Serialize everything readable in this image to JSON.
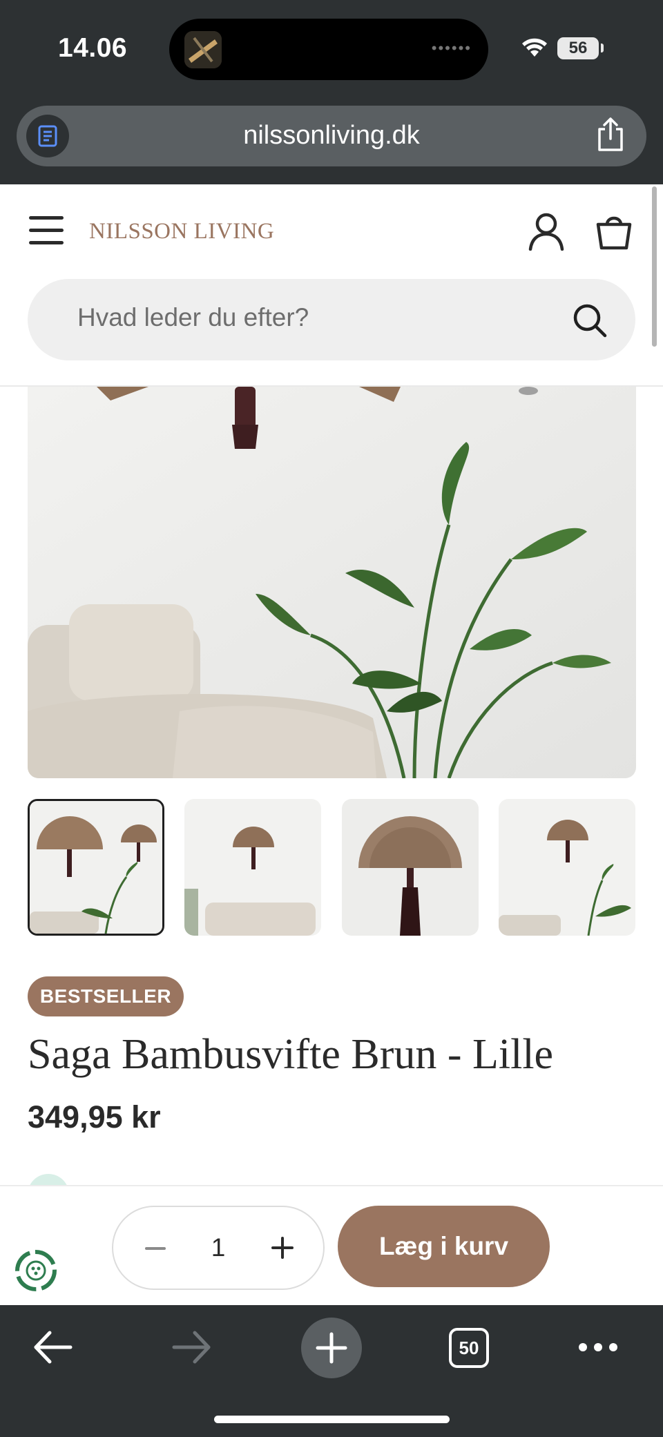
{
  "status_bar": {
    "time": "14.06",
    "battery": "56"
  },
  "browser": {
    "url": "nilssonliving.dk",
    "tab_count": "50"
  },
  "header": {
    "brand": "NILSSON LIVING",
    "search_placeholder": "Hvad leder du efter?"
  },
  "product": {
    "badge": "BESTSELLER",
    "title": "Saga Bambusvifte Brun - Lille",
    "price": "349,95 kr",
    "thumbnails": [
      {
        "name": "thumb-large-and-small-fans-with-plant",
        "active": true
      },
      {
        "name": "thumb-fan-above-sofa",
        "active": false
      },
      {
        "name": "thumb-fan-closeup-tassel",
        "active": false
      },
      {
        "name": "thumb-fan-with-plant",
        "active": false
      }
    ]
  },
  "cart": {
    "quantity": "1",
    "add_label": "Læg i kurv"
  },
  "icons": {
    "menu": "hamburger-menu-icon",
    "account": "account-icon",
    "bag": "shopping-bag-icon",
    "search": "search-icon",
    "reader": "reader-mode-icon",
    "share": "share-icon",
    "back": "back-arrow-icon",
    "forward": "forward-arrow-icon",
    "new_tab": "plus-icon",
    "more": "more-dots-icon"
  },
  "colors": {
    "brand_accent": "#9a7560",
    "chrome": "#2d3133",
    "text": "#2a2a2a"
  }
}
